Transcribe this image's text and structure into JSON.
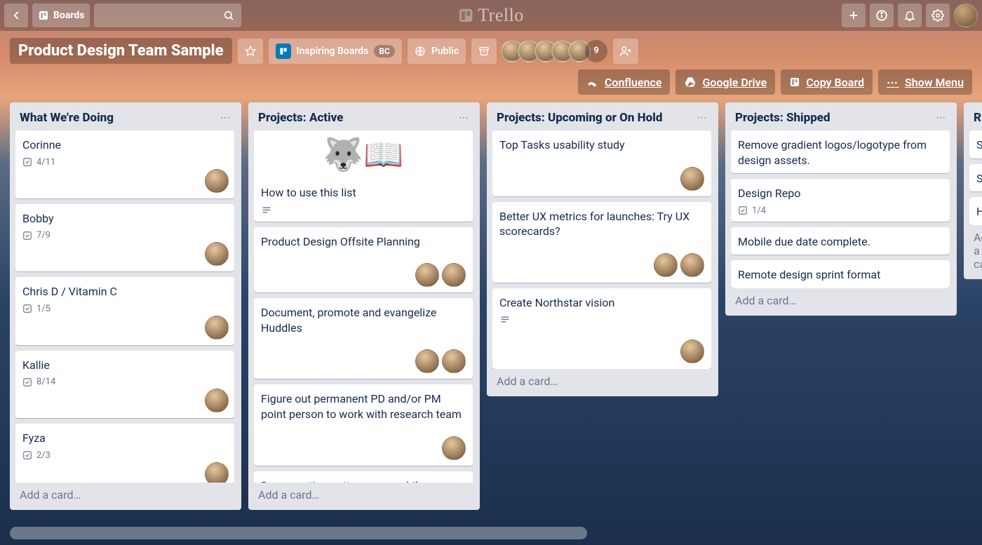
{
  "topbar": {
    "boards_label": "Boards",
    "logo_text": "Trello"
  },
  "board": {
    "title": "Product Design Team Sample",
    "team_label": "Inspiring Boards",
    "team_badge": "BC",
    "visibility_label": "Public",
    "member_overflow": "9"
  },
  "tools": {
    "confluence": "Confluence",
    "drive": "Google Drive",
    "copy": "Copy Board",
    "menu": "Show Menu"
  },
  "add_card_label": "Add a card…",
  "lists": [
    {
      "title": "What We're Doing",
      "show_add": true,
      "cards": [
        {
          "title": "Corinne",
          "checklist": "4/11",
          "avatars": 1,
          "single_avatar": true
        },
        {
          "title": "Bobby",
          "checklist": "7/9",
          "avatars": 1,
          "single_avatar": true
        },
        {
          "title": "Chris D / Vitamin C",
          "checklist": "1/5",
          "avatars": 1,
          "single_avatar": true
        },
        {
          "title": "Kallie",
          "checklist": "8/14",
          "avatars": 1,
          "single_avatar": true
        },
        {
          "title": "Fyza",
          "checklist": "2/3",
          "avatars": 1,
          "single_avatar": true
        }
      ]
    },
    {
      "title": "Projects: Active",
      "show_add": true,
      "cards": [
        {
          "title": "How to use this list",
          "has_desc": true,
          "cover_emoji": "🐺📖"
        },
        {
          "title": "Product Design Offsite Planning",
          "avatars": 2
        },
        {
          "title": "Document, promote and evangelize Huddles",
          "avatars": 2
        },
        {
          "title": "Figure out permanent PD and/or PM point person to work with research team",
          "avatars": 1
        },
        {
          "title": "Documenting patterns on mobile"
        }
      ]
    },
    {
      "title": "Projects: Upcoming or On Hold",
      "show_add": true,
      "cards": [
        {
          "title": "Top Tasks usability study",
          "avatars": 1
        },
        {
          "title": "Better UX metrics for launches: Try UX scorecards?",
          "avatars": 2
        },
        {
          "title": "Create Northstar vision",
          "has_desc": true,
          "avatars": 1
        }
      ]
    },
    {
      "title": "Projects: Shipped",
      "show_add": true,
      "cards": [
        {
          "title": "Remove gradient logos/logotype from design assets."
        },
        {
          "title": "Design Repo",
          "checklist": "1/4"
        },
        {
          "title": "Mobile due date complete."
        },
        {
          "title": "Remote design sprint format"
        }
      ]
    },
    {
      "title": "R",
      "peek": true,
      "show_add": true,
      "cards": [
        {
          "title": "S"
        },
        {
          "title": "S"
        },
        {
          "title": "H"
        }
      ]
    }
  ]
}
